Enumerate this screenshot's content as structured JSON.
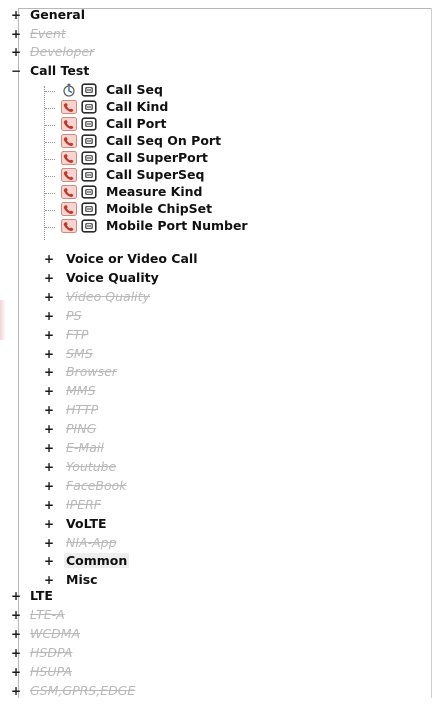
{
  "tree": {
    "top_level": [
      {
        "key": "general",
        "label": "General",
        "toggle": "+",
        "disabled": false
      },
      {
        "key": "event",
        "label": "Event",
        "toggle": "+",
        "disabled": true
      },
      {
        "key": "developer",
        "label": "Developer",
        "toggle": "+",
        "disabled": true
      },
      {
        "key": "call_test",
        "label": "Call Test",
        "toggle": "−",
        "disabled": false
      }
    ],
    "call_test_children": [
      {
        "key": "call_seq",
        "label": "Call Seq",
        "icon": "timer-icon"
      },
      {
        "key": "call_kind",
        "label": "Call Kind",
        "icon": "phone-icon"
      },
      {
        "key": "call_port",
        "label": "Call Port",
        "icon": "phone-icon"
      },
      {
        "key": "call_seq_on_port",
        "label": "Call Seq On Port",
        "icon": "phone-icon"
      },
      {
        "key": "call_superport",
        "label": "Call SuperPort",
        "icon": "phone-icon"
      },
      {
        "key": "call_superseq",
        "label": "Call SuperSeq",
        "icon": "phone-icon"
      },
      {
        "key": "measure_kind",
        "label": "Measure Kind",
        "icon": "phone-icon"
      },
      {
        "key": "moible_chipset",
        "label": "Moible ChipSet",
        "icon": "phone-icon"
      },
      {
        "key": "mobile_port_number",
        "label": "Mobile Port Number",
        "icon": "phone-icon"
      }
    ],
    "mid_level": [
      {
        "key": "voice_or_video_call",
        "label": "Voice or Video Call",
        "toggle": "+",
        "disabled": false
      },
      {
        "key": "voice_quality",
        "label": "Voice Quality",
        "toggle": "+",
        "disabled": false
      },
      {
        "key": "video_quality",
        "label": "Video Quality",
        "toggle": "+",
        "disabled": true
      },
      {
        "key": "ps",
        "label": "PS",
        "toggle": "+",
        "disabled": true
      },
      {
        "key": "ftp",
        "label": "FTP",
        "toggle": "+",
        "disabled": true
      },
      {
        "key": "sms",
        "label": "SMS",
        "toggle": "+",
        "disabled": true
      },
      {
        "key": "browser",
        "label": "Browser",
        "toggle": "+",
        "disabled": true
      },
      {
        "key": "mms",
        "label": "MMS",
        "toggle": "+",
        "disabled": true
      },
      {
        "key": "http",
        "label": "HTTP",
        "toggle": "+",
        "disabled": true
      },
      {
        "key": "ping",
        "label": "PING",
        "toggle": "+",
        "disabled": true
      },
      {
        "key": "email",
        "label": "E-Mail",
        "toggle": "+",
        "disabled": true
      },
      {
        "key": "youtube",
        "label": "Youtube",
        "toggle": "+",
        "disabled": true
      },
      {
        "key": "facebook",
        "label": "FaceBook",
        "toggle": "+",
        "disabled": true
      },
      {
        "key": "iperf",
        "label": "IPERF",
        "toggle": "+",
        "disabled": true
      },
      {
        "key": "volte",
        "label": "VoLTE",
        "toggle": "+",
        "disabled": false
      },
      {
        "key": "nia_app",
        "label": "NIA-App",
        "toggle": "+",
        "disabled": true
      },
      {
        "key": "common",
        "label": "Common",
        "toggle": "+",
        "disabled": false,
        "selected": true
      },
      {
        "key": "misc",
        "label": "Misc",
        "toggle": "+",
        "disabled": false
      }
    ],
    "bottom_level": [
      {
        "key": "lte",
        "label": "LTE",
        "toggle": "+",
        "disabled": false
      },
      {
        "key": "lte_a",
        "label": "LTE-A",
        "toggle": "+",
        "disabled": true
      },
      {
        "key": "wcdma",
        "label": "WCDMA",
        "toggle": "+",
        "disabled": true
      },
      {
        "key": "hsdpa",
        "label": "HSDPA",
        "toggle": "+",
        "disabled": true
      },
      {
        "key": "hsupa",
        "label": "HSUPA",
        "toggle": "+",
        "disabled": true
      },
      {
        "key": "gsm_gprs_edge",
        "label": "GSM,GPRS,EDGE",
        "toggle": "+",
        "disabled": true
      }
    ]
  }
}
